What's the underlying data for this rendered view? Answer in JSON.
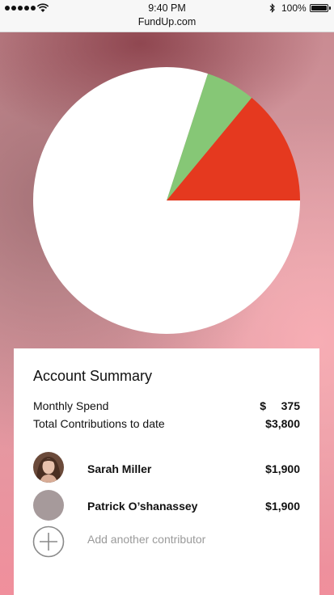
{
  "status_bar": {
    "time": "9:40 PM",
    "battery": "100%",
    "url": "FundUp.com",
    "signal_icon": "signal-dots-icon",
    "wifi_icon": "wifi-icon",
    "bluetooth_icon": "bluetooth-icon",
    "battery_icon": "battery-icon"
  },
  "chart_data": {
    "type": "pie",
    "values_percent": {
      "white_share": 80,
      "green_share": 6,
      "red_share": 14
    },
    "colors": {
      "white_share": "#ffffff",
      "green_share": "#86c776",
      "red_share": "#e5391f"
    }
  },
  "summary": {
    "title": "Account Summary",
    "monthly_spend_label": "Monthly Spend",
    "monthly_spend_currency": "$",
    "monthly_spend_value": "375",
    "total_label": "Total Contributions to date",
    "total_value": "$3,800"
  },
  "contributors": [
    {
      "name": "Sarah Miller",
      "amount": "$1,900"
    },
    {
      "name": "Patrick O’shanassey",
      "amount": "$1,900"
    }
  ],
  "add_contributor": {
    "label": "Add another contributor",
    "icon": "plus-circle-icon"
  }
}
